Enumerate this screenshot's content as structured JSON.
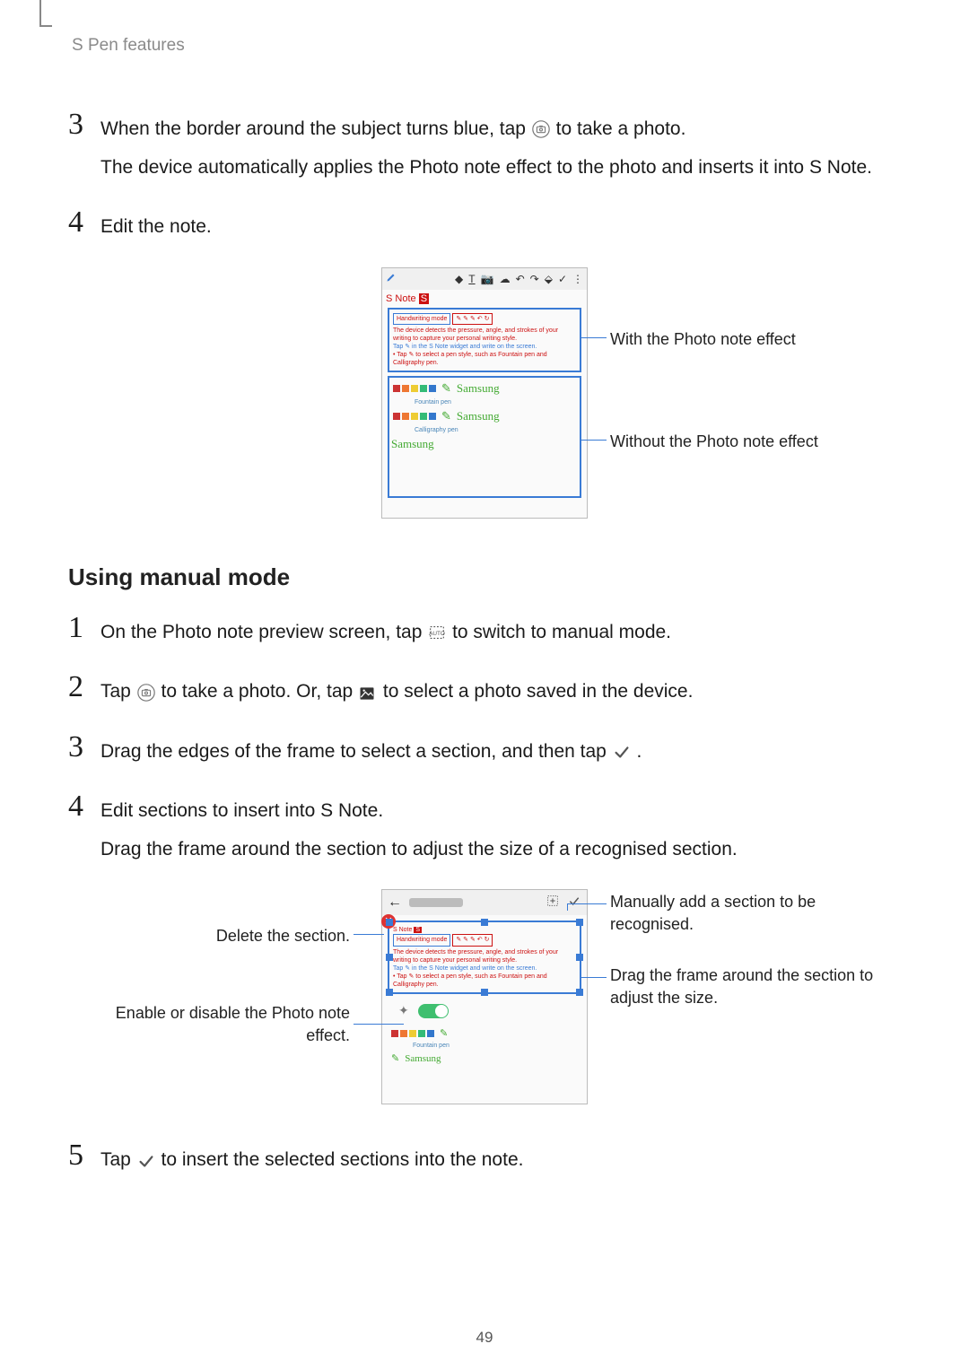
{
  "header": {
    "section_title": "S Pen features"
  },
  "page": {
    "number": "49"
  },
  "top_steps": [
    {
      "num": "3",
      "paras": [
        {
          "pre": "When the border around the subject turns blue, tap ",
          "icon": "camera-icon",
          "post": " to take a photo."
        },
        {
          "full": "The device automatically applies the Photo note effect to the photo and inserts it into S Note."
        }
      ]
    },
    {
      "num": "4",
      "paras": [
        {
          "full": "Edit the note."
        }
      ]
    }
  ],
  "figure1": {
    "snote_label": "S Note",
    "handwriting_label": "Handwriting mode",
    "effect_line1": "The device detects the pressure, angle, and strokes of your writing to capture your personal writing style.",
    "effect_line2": "Tap ✎ in the S Note widget and write on the screen.",
    "effect_line3": "• Tap ✎ to select a pen style, such as Fountain pen and Calligraphy pen.",
    "fountain_label": "Fountain pen",
    "calligraphy_label": "Calligraphy pen",
    "cursive1": "Samsung",
    "cursive2": "Samsung",
    "cursive3": "Samsung",
    "callout_with": "With the Photo note effect",
    "callout_without": "Without the Photo note effect"
  },
  "section_title_2": "Using manual mode",
  "manual_steps": [
    {
      "num": "1",
      "parts": [
        {
          "pre": "On the Photo note preview screen, tap ",
          "icon": "auto-mode-icon",
          "post": " to switch to manual mode."
        }
      ]
    },
    {
      "num": "2",
      "parts": [
        {
          "pre": "Tap ",
          "icon": "camera-icon",
          "mid": " to take a photo. Or, tap ",
          "icon2": "gallery-icon",
          "post": " to select a photo saved in the device."
        }
      ]
    },
    {
      "num": "3",
      "parts": [
        {
          "pre": "Drag the edges of the frame to select a section, and then tap ",
          "icon": "check-icon",
          "post": "."
        }
      ]
    },
    {
      "num": "4",
      "paras": [
        {
          "full": "Edit sections to insert into S Note."
        },
        {
          "full": "Drag the frame around the section to adjust the size of a recognised section."
        }
      ]
    }
  ],
  "figure2": {
    "snote_label": "S Note",
    "handwriting_label": "Handwriting mode",
    "body_line1": "The device detects the pressure, angle, and strokes of your writing to capture your personal writing style.",
    "body_line2": "Tap ✎ in the S Note widget and write on the screen.",
    "body_line3": "• Tap ✎ to select a pen style, such as Fountain pen and Calligraphy pen.",
    "fountain_label": "Fountain pen",
    "cursive1": "Samsung",
    "callout_add": "Manually add a section to be recognised.",
    "callout_drag": "Drag the frame around the section to adjust the size.",
    "callout_delete": "Delete the section.",
    "callout_toggle": "Enable or disable the Photo note effect."
  },
  "step5": {
    "num": "5",
    "pre": "Tap ",
    "post": " to insert the selected sections into the note."
  }
}
